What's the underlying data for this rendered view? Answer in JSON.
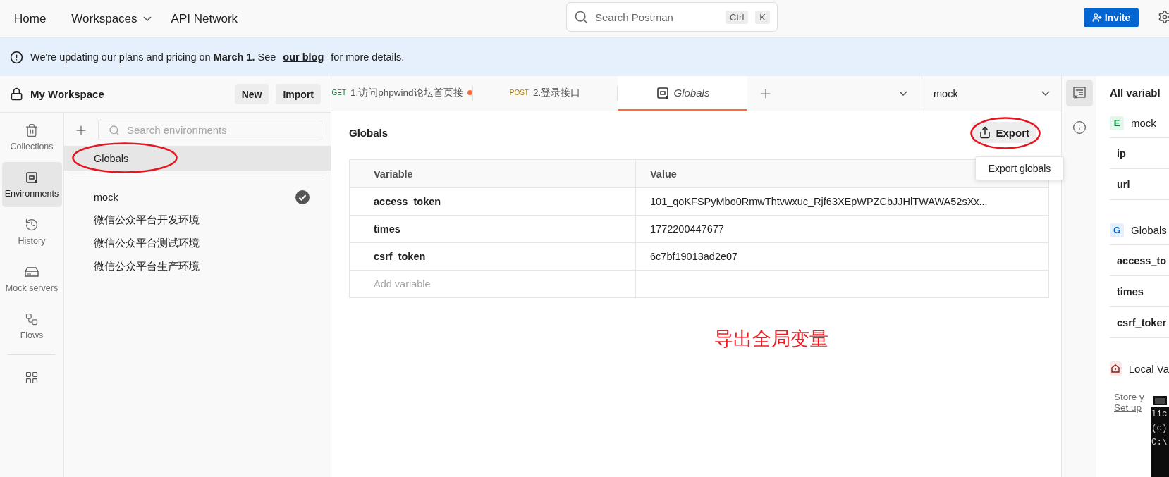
{
  "top_bar": {
    "nav": [
      {
        "label": "Home",
        "dropdown": false
      },
      {
        "label": "Workspaces",
        "dropdown": true
      },
      {
        "label": "API Network",
        "dropdown": false
      }
    ],
    "search": {
      "placeholder": "Search Postman",
      "shortcut": [
        "Ctrl",
        "K"
      ]
    },
    "invite_button": "Invite"
  },
  "banner": {
    "text": "We're updating our plans and pricing on **March 1.** See",
    "link": "our blog",
    "tail": "for more details."
  },
  "workspace": {
    "title": "My Workspace",
    "buttons": [
      "New",
      "Import"
    ]
  },
  "sidebar": {
    "items": [
      {
        "label": "Collections",
        "selected": false
      },
      {
        "label": "Environments",
        "selected": true
      },
      {
        "label": "History",
        "selected": false
      },
      {
        "label": "Mock servers",
        "selected": false
      },
      {
        "label": "Flows",
        "selected": false
      }
    ]
  },
  "environments": {
    "search": {
      "placeholder": "Search environments"
    },
    "globals": {
      "label": "Globals",
      "selected": true,
      "circled": true
    },
    "items": [
      {
        "label": "mock",
        "active": true,
        "selected": false
      },
      {
        "label": "微信公众平台开发环境",
        "active": false,
        "selected": false
      },
      {
        "label": "微信公众平台测试环境",
        "active": false,
        "selected": false
      },
      {
        "label": "微信公众平台生产环境",
        "active": false,
        "selected": false
      }
    ]
  },
  "tabs": [
    {
      "kind": "request",
      "method": "GET",
      "title": "1.访问phpwind论坛首页接",
      "unsaved": true,
      "selected": false
    },
    {
      "kind": "request",
      "method": "POST",
      "title": "2.登录接口",
      "unsaved": false,
      "selected": false
    },
    {
      "kind": "globals",
      "title": "Globals",
      "unsaved": false,
      "selected": true
    }
  ],
  "environment_select": "mock",
  "globals_panel": {
    "title": "Globals",
    "export_button": {
      "label": "Export",
      "circled": true
    },
    "tooltip": "Export globals",
    "columns": [
      "Variable",
      "Value"
    ],
    "rows": [
      {
        "variable": "access_token",
        "value": "101_qoKFSPyMbo0RmwThtvwxuc_Rjf63XEpWPZCbJJHlTWAWA52sXx..."
      },
      {
        "variable": "times",
        "value": "1772200447677"
      },
      {
        "variable": "csrf_token",
        "value": "6c7bf19013ad2e07"
      }
    ],
    "add_placeholder": "Add variable"
  },
  "annotation": "导出全局变量",
  "right_panel": {
    "title": "All variabl",
    "groups": [
      {
        "badge": "E",
        "name": "mock",
        "kind": "environment",
        "variables": [
          "ip",
          "url"
        ]
      },
      {
        "badge": "G",
        "name": "Globals",
        "kind": "globals",
        "variables": [
          "access_to",
          "times",
          "csrf_toker"
        ]
      },
      {
        "name": "Local Va",
        "kind": "local"
      }
    ],
    "note": "Store y",
    "note_link": "Set up"
  },
  "console_window": {
    "lines": [
      "lic",
      "(c)",
      "C:\\"
    ]
  }
}
